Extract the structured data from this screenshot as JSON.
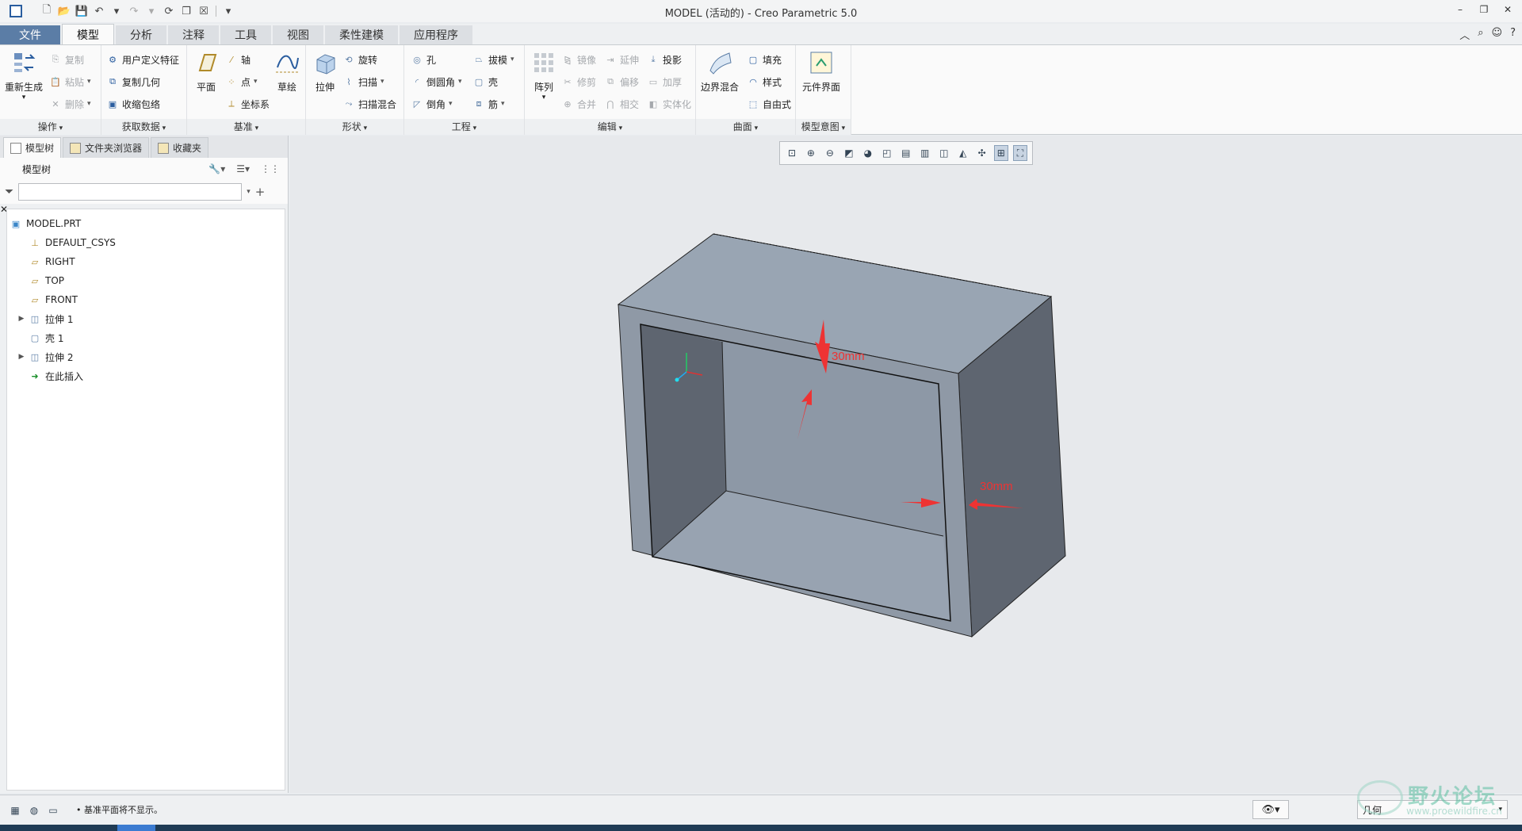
{
  "window": {
    "title": "MODEL (活动的) - Creo Parametric 5.0",
    "controls": [
      "–",
      "❐",
      "✕"
    ]
  },
  "quick_access": {
    "icons": [
      "new-icon",
      "open-icon",
      "save-icon",
      "undo-icon",
      "redo-icon",
      "regenerate-icon",
      "windows-icon",
      "close-icon",
      "customize-icon"
    ]
  },
  "tabs": [
    {
      "label": "文件",
      "kind": "file"
    },
    {
      "label": "模型",
      "kind": "active"
    },
    {
      "label": "分析"
    },
    {
      "label": "注释"
    },
    {
      "label": "工具"
    },
    {
      "label": "视图"
    },
    {
      "label": "柔性建模"
    },
    {
      "label": "应用程序"
    }
  ],
  "ribbon": {
    "operations": {
      "label": "操作",
      "regenerate": "重新生成",
      "copy": "复制",
      "paste": "粘贴",
      "delete": "删除"
    },
    "get_data": {
      "label": "获取数据",
      "udf": "用户定义特征",
      "copy_geom": "复制几何",
      "shrinkwrap": "收缩包络"
    },
    "datum": {
      "label": "基准",
      "plane": "平面",
      "axis": "轴",
      "point": "点",
      "csys": "坐标系",
      "sketch": "草绘"
    },
    "shapes": {
      "label": "形状",
      "extrude": "拉伸",
      "revolve": "旋转",
      "sweep": "扫描",
      "swept_blend": "扫描混合"
    },
    "engineering": {
      "label": "工程",
      "hole": "孔",
      "round": "倒圆角",
      "chamfer": "倒角",
      "draft": "拔模",
      "shell": "壳",
      "rib": "筋"
    },
    "editing": {
      "label": "编辑",
      "pattern": "阵列",
      "mirror": "镜像",
      "trim": "修剪",
      "merge": "合并",
      "extend": "延伸",
      "offset": "偏移",
      "intersect": "相交",
      "project": "投影",
      "thicken": "加厚",
      "solidify": "实体化"
    },
    "surfaces": {
      "label": "曲面",
      "boundary_blend": "边界混合",
      "fill": "填充",
      "style": "样式",
      "freestyle": "自由式"
    },
    "model_intent": {
      "label": "模型意图",
      "component_interface": "元件界面"
    }
  },
  "left_panel": {
    "tabs": [
      "模型树",
      "文件夹浏览器",
      "收藏夹"
    ],
    "tree_title": "模型树",
    "filter_placeholder": "",
    "tree_items": [
      {
        "label": "MODEL.PRT",
        "icon": "part-icon",
        "expandable": false,
        "level": 0
      },
      {
        "label": "DEFAULT_CSYS",
        "icon": "csys-icon",
        "expandable": false,
        "level": 1
      },
      {
        "label": "RIGHT",
        "icon": "datum-plane-icon",
        "expandable": false,
        "level": 1
      },
      {
        "label": "TOP",
        "icon": "datum-plane-icon",
        "expandable": false,
        "level": 1
      },
      {
        "label": "FRONT",
        "icon": "datum-plane-icon",
        "expandable": false,
        "level": 1
      },
      {
        "label": "拉伸 1",
        "icon": "extrude-icon",
        "expandable": true,
        "level": 1
      },
      {
        "label": "壳 1",
        "icon": "shell-icon",
        "expandable": false,
        "level": 1
      },
      {
        "label": "拉伸 2",
        "icon": "extrude-icon",
        "expandable": true,
        "level": 1
      },
      {
        "label": "在此插入",
        "icon": "insert-arrow-icon",
        "expandable": false,
        "level": 1
      }
    ]
  },
  "graphics": {
    "annotations": [
      "30mm",
      "30mm"
    ],
    "view_toolbar_icons": [
      "refit-icon",
      "zoom-in-icon",
      "zoom-out-icon",
      "repaint-icon",
      "display-style-icon",
      "saved-orientations-icon",
      "view-manager-icon",
      "perspective-icon",
      "datum-display-icon",
      "spin-center-icon",
      "annotation-display-icon",
      "model-tree-display-icon",
      "snapshot-icon"
    ],
    "colors": {
      "face_top": "#99a5b3",
      "face_side": "#5e6570",
      "face_front": "#8f99a6",
      "dim_arrow": "#ee3333"
    }
  },
  "statusbar": {
    "message": "• 基准平面将不显示。",
    "selection_filter": "几何",
    "watermark_title": "野火论坛",
    "watermark_url": "www.proewildfire.cn"
  }
}
